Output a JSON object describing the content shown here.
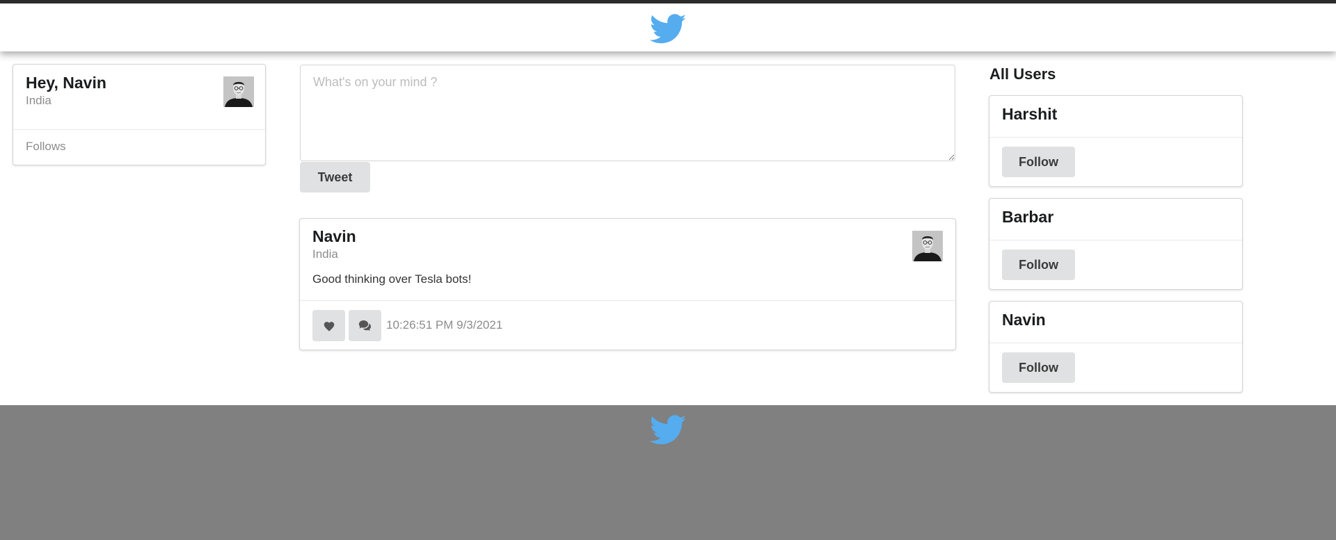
{
  "header": {
    "logo_icon": "twitter-bird-icon",
    "logo_color": "#55acee"
  },
  "profile": {
    "greeting": "Hey, Navin",
    "country": "India",
    "follows_label": "Follows"
  },
  "composer": {
    "placeholder": "What's on your mind ?",
    "value": "",
    "tweet_label": "Tweet"
  },
  "tweets": [
    {
      "author": "Navin",
      "country": "India",
      "text": "Good thinking over Tesla bots!",
      "timestamp": "10:26:51 PM 9/3/2021",
      "like_icon": "heart-icon",
      "comment_icon": "comments-icon"
    }
  ],
  "users": {
    "title": "All Users",
    "list": [
      {
        "name": "Harshit",
        "follow_label": "Follow"
      },
      {
        "name": "Barbar",
        "follow_label": "Follow"
      },
      {
        "name": "Navin",
        "follow_label": "Follow"
      }
    ]
  },
  "footer": {
    "logo_icon": "twitter-bird-icon",
    "background": "#808080"
  }
}
